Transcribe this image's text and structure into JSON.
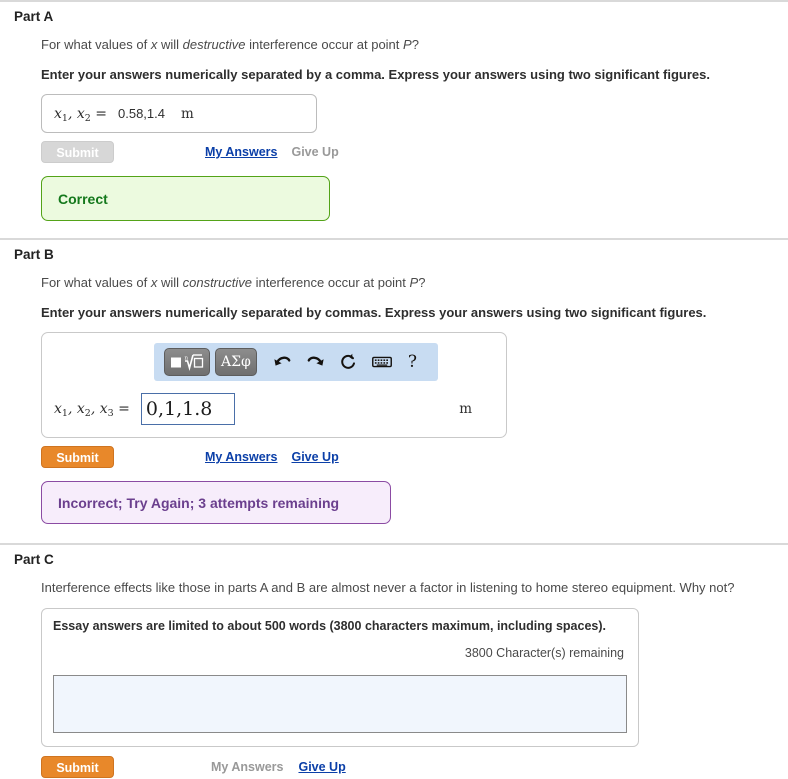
{
  "parts": [
    {
      "title": "Part A",
      "question_prefix": "For what values of ",
      "question_var": "x",
      "question_mid": " will ",
      "question_em": "destructive",
      "question_mid2": " interference occur at point ",
      "question_point": "P",
      "question_suffix": "?",
      "instruction": "Enter your answers numerically separated by a comma. Express your answers using two significant figures.",
      "answer_label_vars": [
        "x",
        "x"
      ],
      "answer_label_subs": [
        "1",
        "2"
      ],
      "answer_equals": "=",
      "answer_value": "0.58,1.4",
      "unit": "m",
      "submit_label": "Submit",
      "my_answers_label": "My Answers",
      "give_up_label": "Give Up",
      "feedback": "Correct"
    },
    {
      "title": "Part B",
      "question_prefix": "For what values of ",
      "question_var": "x",
      "question_mid": " will ",
      "question_em": "constructive",
      "question_mid2": " interference occur at point ",
      "question_point": "P",
      "question_suffix": "?",
      "instruction": "Enter your answers numerically separated by commas. Express your answers using two significant figures.",
      "answer_label_vars": [
        "x",
        "x",
        "x"
      ],
      "answer_label_subs": [
        "1",
        "2",
        "3"
      ],
      "answer_equals": "=",
      "answer_value": "0,1,1.8",
      "unit": "m",
      "submit_label": "Submit",
      "my_answers_label": "My Answers",
      "give_up_label": "Give Up",
      "feedback": "Incorrect; Try Again; 3 attempts remaining",
      "toolbar": {
        "template_button": "template-math-icon",
        "greek_button": "ΑΣφ",
        "undo_icon": "undo-icon",
        "redo_icon": "redo-icon",
        "reset_icon": "reset-icon",
        "keyboard_icon": "keyboard-icon",
        "help_label": "?"
      }
    },
    {
      "title": "Part C",
      "question_full": "Interference effects like those in parts A and B are almost never a factor in listening to home stereo equipment. Why not?",
      "essay_note": "Essay answers are limited to about 500 words (3800 characters maximum, including spaces).",
      "essay_count": "3800 Character(s) remaining",
      "essay_value": "",
      "submit_label": "Submit",
      "my_answers_label": "My Answers",
      "give_up_label": "Give Up"
    }
  ],
  "colors": {
    "submit_orange": "#e8882a",
    "link_blue": "#0b3fa8",
    "correct_bg": "#ecfadf",
    "correct_border": "#53a318",
    "correct_text": "#14781c",
    "incorrect_bg": "#f7edfb",
    "incorrect_border": "#8b4ba3",
    "incorrect_text": "#6b3f8e",
    "toolbar_bg": "#c8dcf2",
    "textarea_bg": "#f1f6fd"
  }
}
